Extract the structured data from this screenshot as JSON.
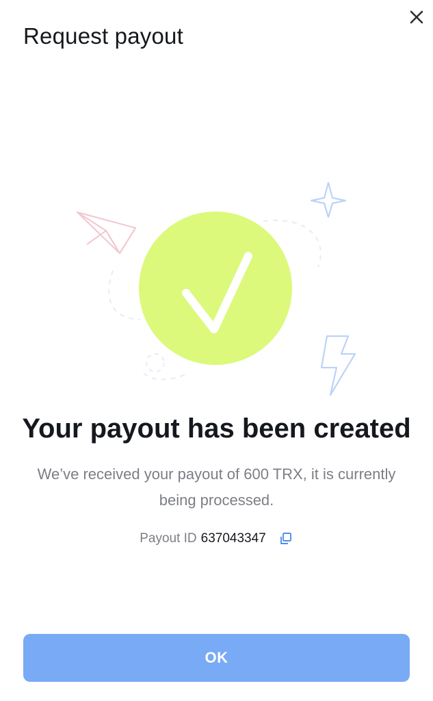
{
  "header": {
    "title": "Request payout",
    "close_icon": "close-icon"
  },
  "illustration": {
    "icons": [
      "paper-plane-icon",
      "sparkle-icon",
      "checkmark-icon",
      "lightning-icon"
    ],
    "circle_color": "#dcf97c",
    "accent_blue": "#bcd3f7",
    "accent_pink": "#f3c9cf"
  },
  "result": {
    "headline": "Your payout has been created",
    "message": "We’ve received your payout of 600 TRX, it is currently being processed.",
    "payout_id_label": "Payout ID",
    "payout_id_value": "637043347",
    "copy_icon": "copy-icon"
  },
  "actions": {
    "ok_label": "OK",
    "ok_color": "#79aaf6"
  }
}
